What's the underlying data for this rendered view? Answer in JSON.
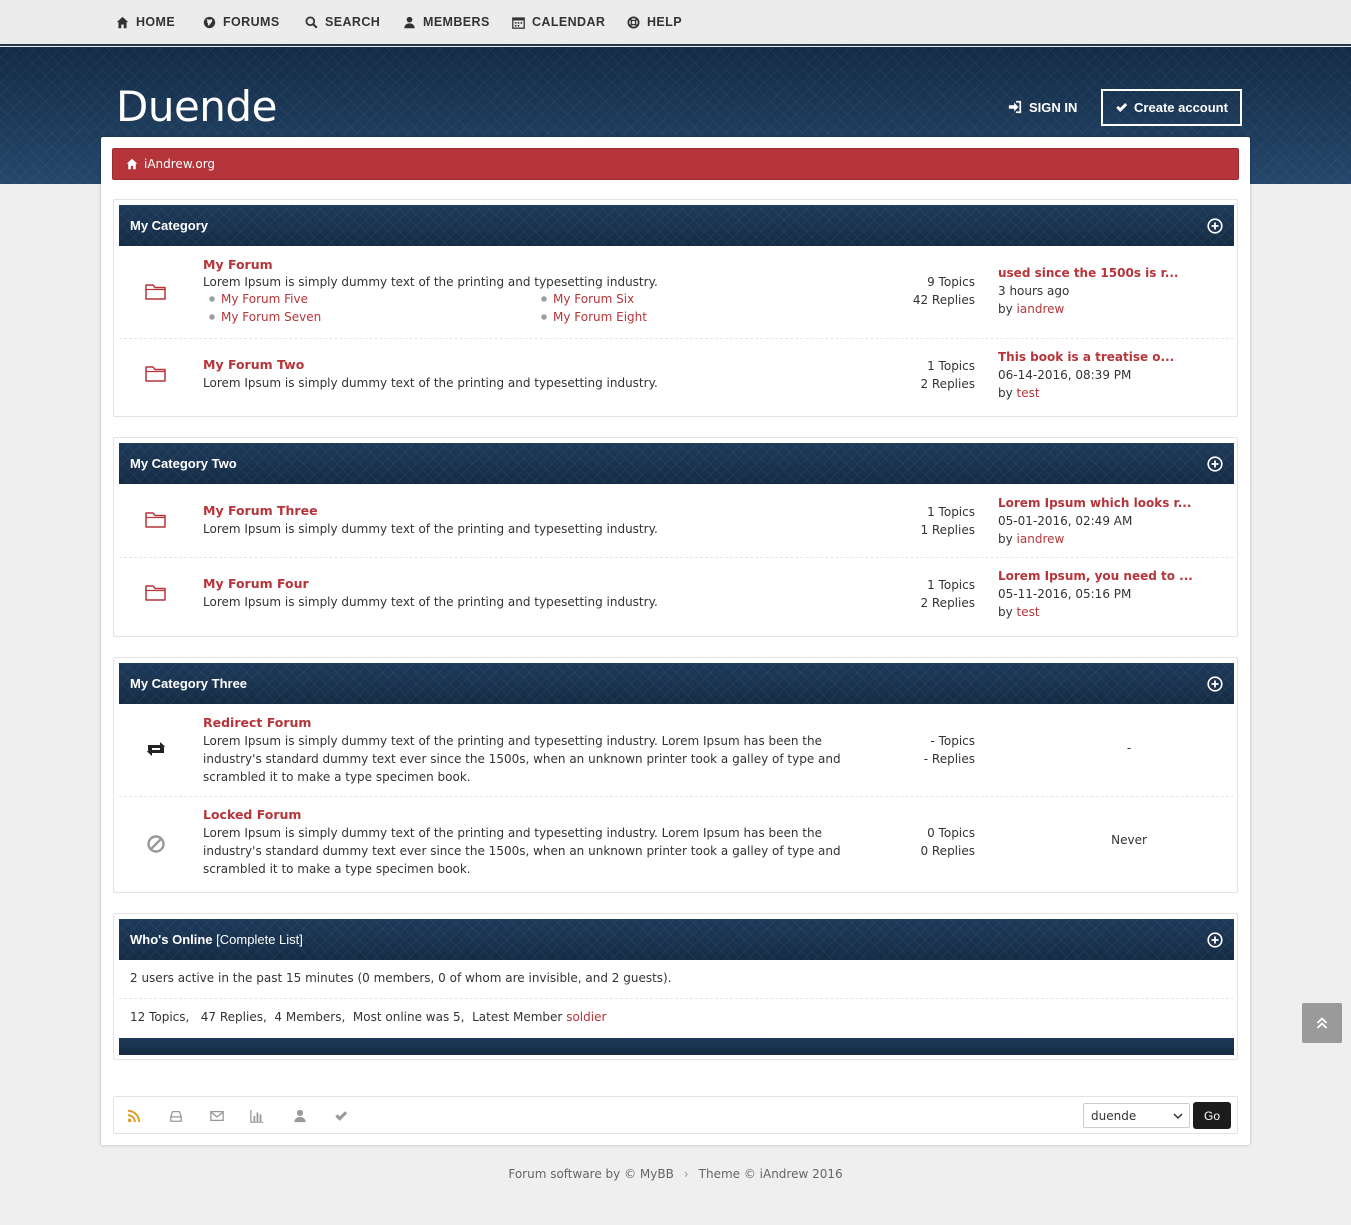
{
  "nav": {
    "items": [
      {
        "label": "HOME",
        "icon": "home-icon"
      },
      {
        "label": "FORUMS",
        "icon": "globe-icon"
      },
      {
        "label": "SEARCH",
        "icon": "search-icon"
      },
      {
        "label": "MEMBERS",
        "icon": "user-icon"
      },
      {
        "label": "CALENDAR",
        "icon": "calendar-icon"
      },
      {
        "label": "HELP",
        "icon": "lifebuoy-icon"
      }
    ]
  },
  "header": {
    "logo": "Duende",
    "sign_in": "SIGN IN",
    "create_account": "Create account"
  },
  "breadcrumb": {
    "label": "iAndrew.org"
  },
  "categories": [
    {
      "title": "My Category",
      "forums": [
        {
          "name": "My Forum",
          "description": "Lorem Ipsum is simply dummy text of the printing and typesetting industry.",
          "subforums": [
            "My Forum Five",
            "My Forum Six",
            "My Forum Seven",
            "My Forum Eight"
          ],
          "topics": "9 Topics",
          "replies": "42 Replies",
          "last_title": "used since the 1500s is r...",
          "last_time": "3 hours ago",
          "last_by": "by",
          "last_user": "iandrew"
        },
        {
          "name": "My Forum Two",
          "description": "Lorem Ipsum is simply dummy text of the printing and typesetting industry.",
          "topics": "1 Topics",
          "replies": "2 Replies",
          "last_title": "This book is a treatise o...",
          "last_time": "06-14-2016, 08:39 PM",
          "last_by": "by",
          "last_user": "test"
        }
      ]
    },
    {
      "title": "My Category Two",
      "forums": [
        {
          "name": "My Forum Three",
          "description": "Lorem Ipsum is simply dummy text of the printing and typesetting industry.",
          "topics": "1 Topics",
          "replies": "1 Replies",
          "last_title": "Lorem Ipsum which looks r...",
          "last_time": "05-01-2016, 02:49 AM",
          "last_by": "by",
          "last_user": "iandrew"
        },
        {
          "name": "My Forum Four",
          "description": "Lorem Ipsum is simply dummy text of the printing and typesetting industry.",
          "topics": "1 Topics",
          "replies": "2 Replies",
          "last_title": "Lorem Ipsum, you need to ...",
          "last_time": "05-11-2016, 05:16 PM",
          "last_by": "by",
          "last_user": "test"
        }
      ]
    },
    {
      "title": "My Category Three",
      "forums": [
        {
          "name": "Redirect Forum",
          "description": "Lorem Ipsum is simply dummy text of the printing and typesetting industry. Lorem Ipsum has been the industry's standard dummy text ever since the 1500s, when an unknown printer took a galley of type and scrambled it to make a type specimen book.",
          "topics": "- Topics",
          "replies": "- Replies",
          "last": "-"
        },
        {
          "name": "Locked Forum",
          "description": "Lorem Ipsum is simply dummy text of the printing and typesetting industry. Lorem Ipsum has been the industry's standard dummy text ever since the 1500s, when an unknown printer took a galley of type and scrambled it to make a type specimen book.",
          "topics": "0 Topics",
          "replies": "0 Replies",
          "last": "Never"
        }
      ]
    }
  ],
  "online": {
    "title": "Who's Online",
    "complete_list": "[Complete List]",
    "active_line": "2 users active in the past 15 minutes (0 members, 0 of whom are invisible, and 2 guests).",
    "stats_line": "12 Topics,   47 Replies,  4 Members,  Most online was 5,  Latest Member",
    "latest_member": "soldier"
  },
  "footer": {
    "theme_selected": "duende",
    "go_label": "Go",
    "powered": "Forum software by © MyBB",
    "theme_credit": "Theme © iAndrew 2016",
    "separator": "›"
  },
  "colors": {
    "accent": "#b5353a",
    "header_navy": "#1c3553",
    "rss": "#e09a2b"
  }
}
